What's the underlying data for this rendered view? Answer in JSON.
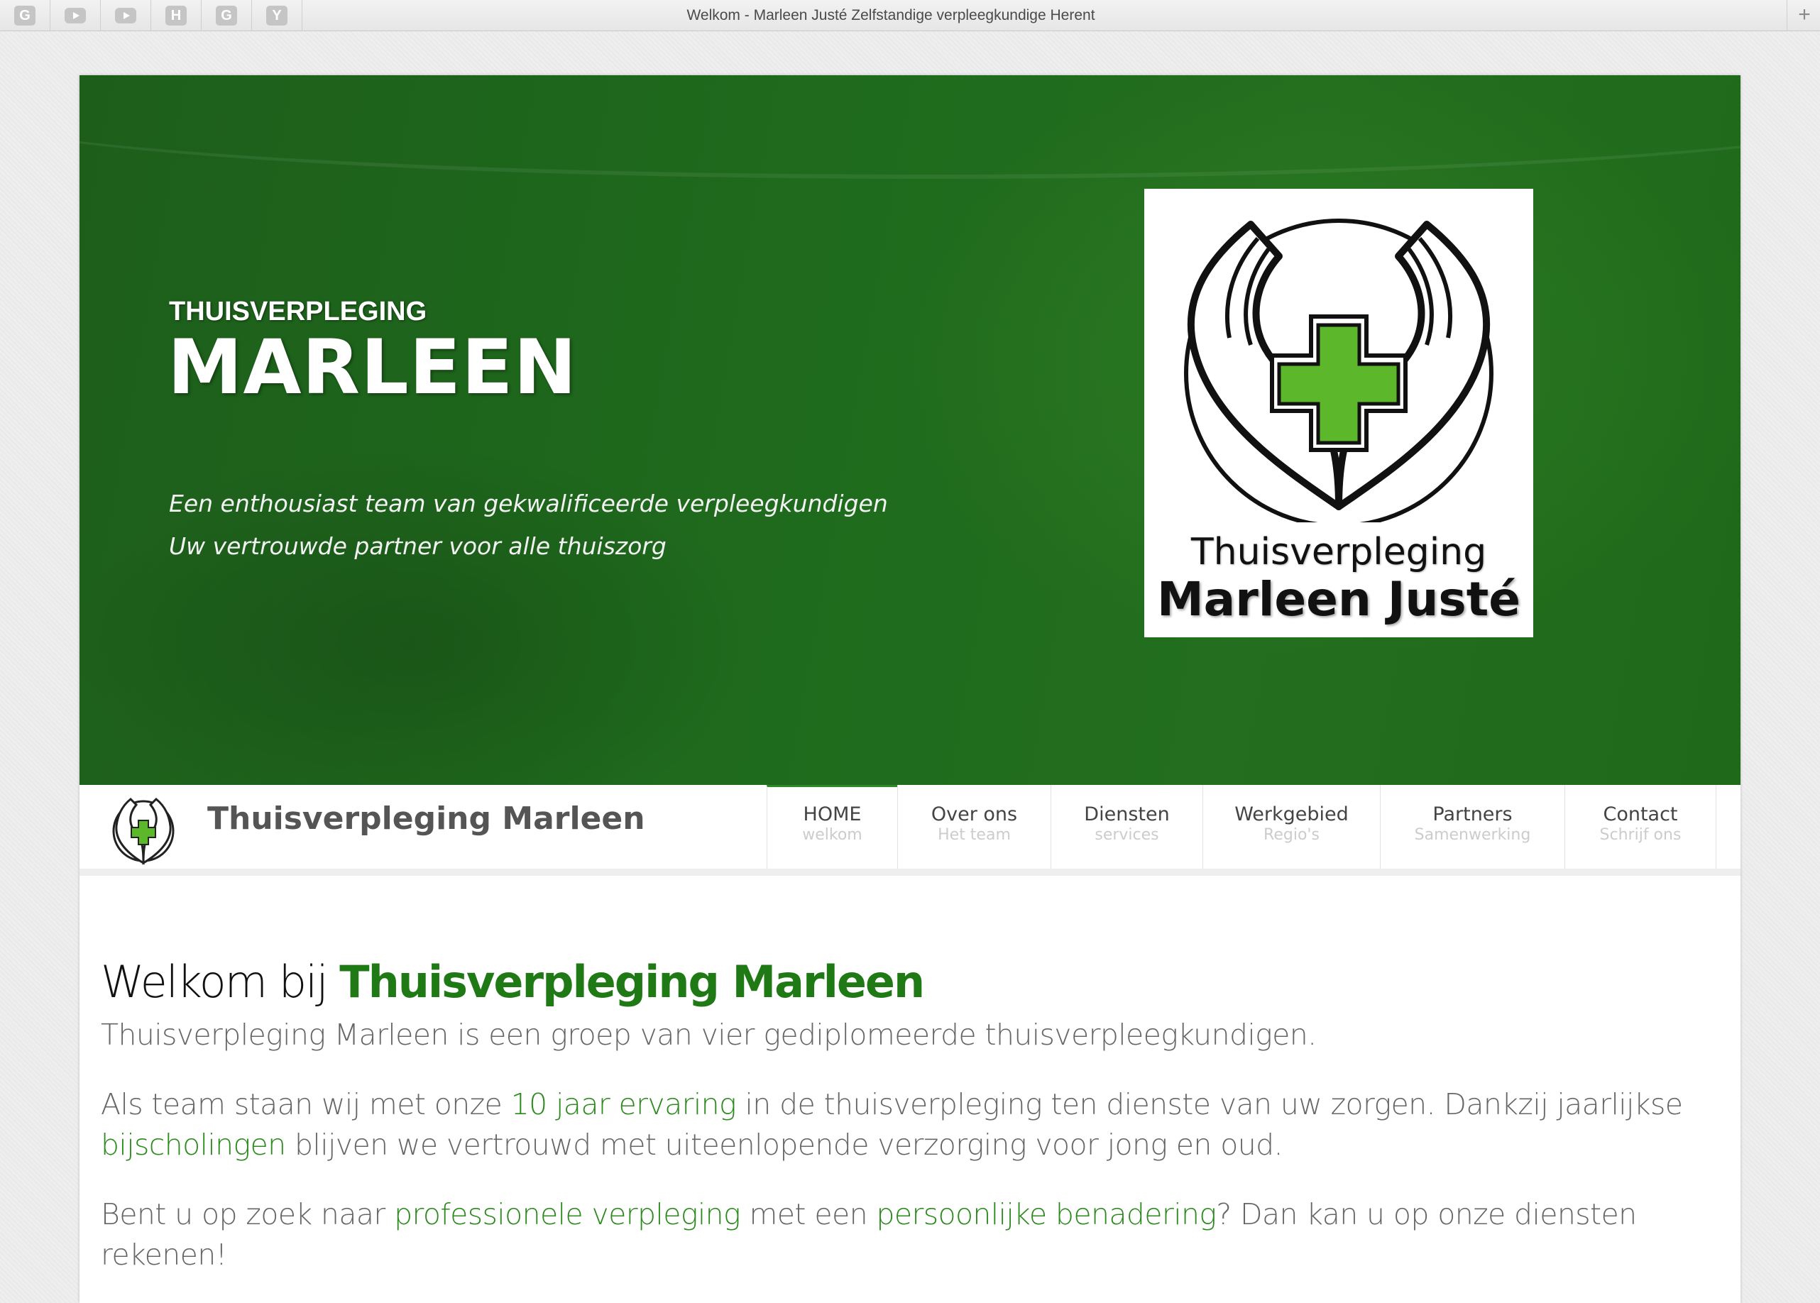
{
  "browser": {
    "pinned_tabs": [
      {
        "icon": "google-icon",
        "letter": "G"
      },
      {
        "icon": "youtube-icon",
        "letter": ""
      },
      {
        "icon": "youtube-icon",
        "letter": ""
      },
      {
        "icon": "h-icon",
        "letter": "H"
      },
      {
        "icon": "google-icon",
        "letter": "G"
      },
      {
        "icon": "y-icon",
        "letter": "Y"
      }
    ],
    "tab_title": "Welkom - Marleen Justé Zelfstandige verpleegkundige Herent",
    "new_tab_label": "+"
  },
  "hero": {
    "subtitle": "THUISVERPLEGING",
    "title": "MARLEEN",
    "line1": "Een enthousiast team van gekwalificeerde verpleegkundigen",
    "line2": "Uw vertrouwde partner voor alle thuiszorg",
    "logo_line1": "Thuisverpleging",
    "logo_line2": "Marleen Justé"
  },
  "nav": {
    "brand": "Thuisverpleging Marleen",
    "items": [
      {
        "label": "HOME",
        "sub": "welkom"
      },
      {
        "label": "Over ons",
        "sub": "Het team"
      },
      {
        "label": "Diensten",
        "sub": "services"
      },
      {
        "label": "Werkgebied",
        "sub": "Regio's"
      },
      {
        "label": "Partners",
        "sub": "Samenwerking"
      },
      {
        "label": "Contact",
        "sub": "Schrijf ons"
      }
    ]
  },
  "content": {
    "heading_prefix": "Welkom bij ",
    "heading_accent": "Thuisverpleging Marleen",
    "p1": "Thuisverpleging Marleen is een groep van vier gediplomeerde thuisverpleegkundigen.",
    "p2": {
      "a": "Als team staan wij met onze ",
      "b": "10 jaar ervaring",
      "c": " in de thuisverpleging ten dienste van uw zorgen. Dankzij jaarlijkse ",
      "d": "bijscholingen",
      "e": " blijven we vertrouwd met uiteenlopende verzorging voor jong en oud."
    },
    "p3": {
      "a": "Bent u op zoek naar ",
      "b": "professionele verpleging",
      "c": " met een ",
      "d": "persoonlijke benadering",
      "e": "? Dan kan u op onze diensten rekenen!"
    }
  },
  "colors": {
    "accent_green": "#1f7a15",
    "link_green": "#2c8a1e",
    "hero_green": "#1f6b1d",
    "cross_green": "#5cb82a"
  }
}
